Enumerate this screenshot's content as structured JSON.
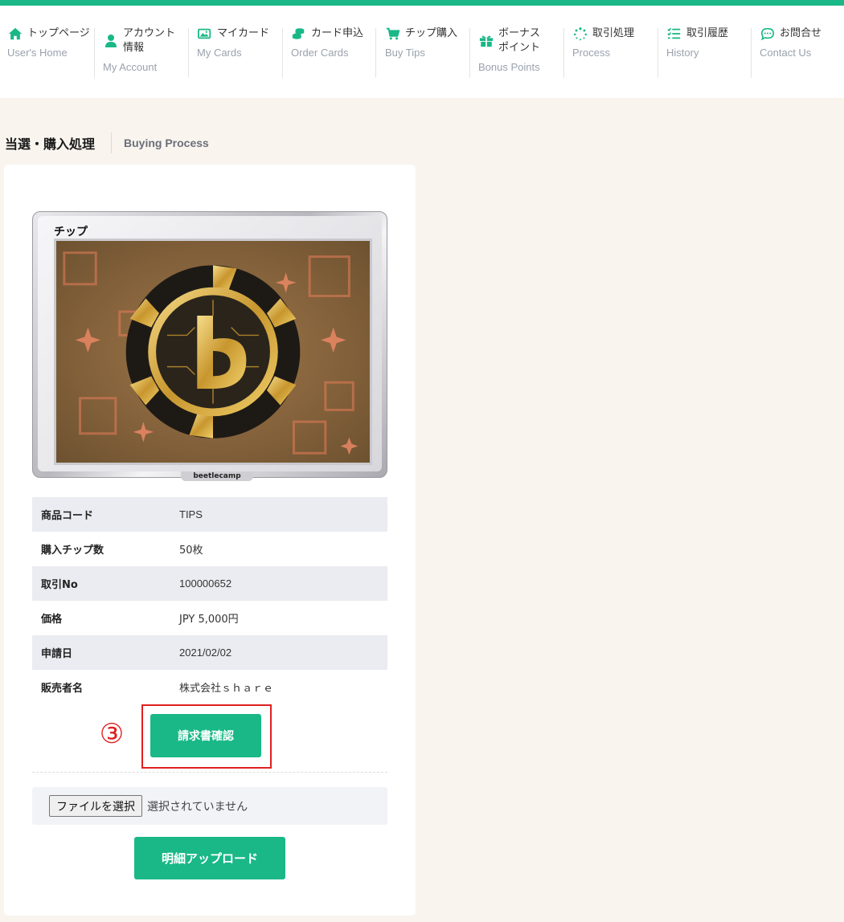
{
  "nav": {
    "items": [
      {
        "jp": "トップページ",
        "en": "User's Home",
        "icon": "home-icon"
      },
      {
        "jp": "アカウント",
        "jp2": "情報",
        "en": "My Account",
        "icon": "user-icon"
      },
      {
        "jp": "マイカード",
        "en": "My Cards",
        "icon": "image-icon"
      },
      {
        "jp": "カード申込",
        "en": "Order Cards",
        "icon": "coins-icon"
      },
      {
        "jp": "チップ購入",
        "en": "Buy Tips",
        "icon": "cart-icon"
      },
      {
        "jp": "ボーナス",
        "jp2": "ポイント",
        "en": "Bonus Points",
        "icon": "gift-icon"
      },
      {
        "jp": "取引処理",
        "en": "Process",
        "icon": "spinner-icon"
      },
      {
        "jp": "取引履歴",
        "en": "History",
        "icon": "checklist-icon"
      },
      {
        "jp": "お問合せ",
        "en": "Contact Us",
        "icon": "chat-icon"
      }
    ]
  },
  "section": {
    "title_jp": "当選・購入処理",
    "title_en": "Buying Process"
  },
  "card": {
    "label": "チップ",
    "brand": "beetlecamp"
  },
  "details": [
    {
      "label": "商品コード",
      "value": "TIPS"
    },
    {
      "label": "購入チップ数",
      "value": "50枚"
    },
    {
      "label": "取引No",
      "value": "100000652"
    },
    {
      "label": "価格",
      "value": "JPY 5,000円"
    },
    {
      "label": "申請日",
      "value": "2021/02/02"
    },
    {
      "label": "販売者名",
      "value": "株式会社ｓｈａｒｅ"
    }
  ],
  "step_marker": "③",
  "invoice_button": "請求書確認",
  "file": {
    "button": "ファイルを選択",
    "status": "選択されていません"
  },
  "upload_button": "明細アップロード",
  "colors": {
    "accent": "#19b886",
    "highlight": "#e02020",
    "background": "#f9f4ee"
  }
}
